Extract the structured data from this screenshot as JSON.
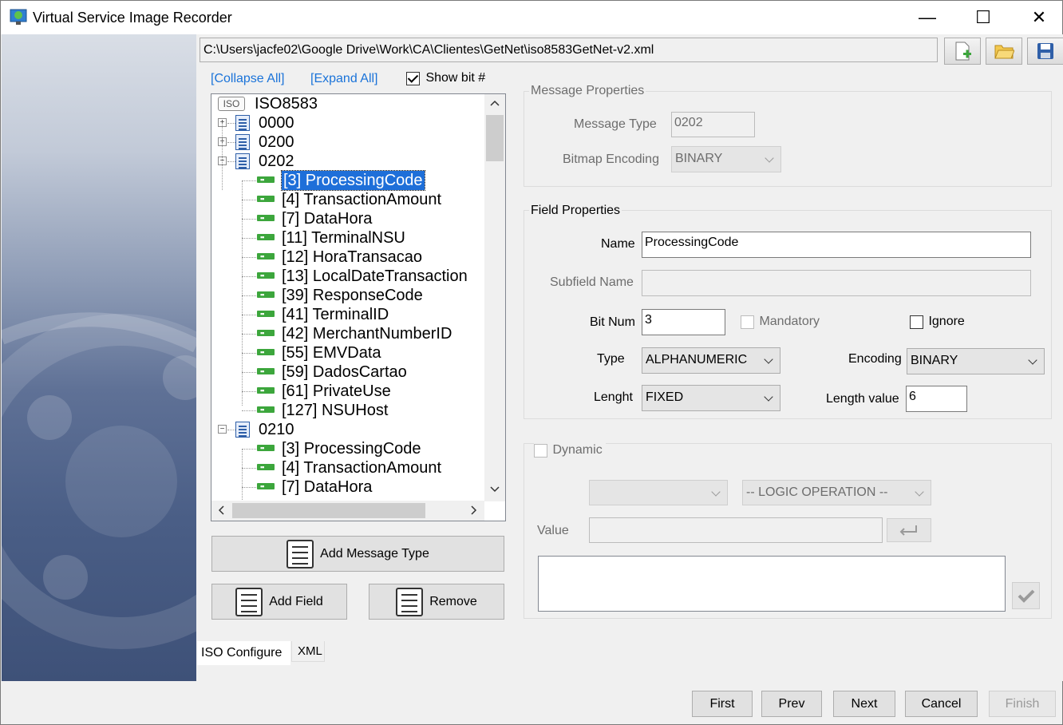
{
  "window": {
    "title": "Virtual Service Image Recorder",
    "minimize": "—",
    "maximize": "☐",
    "close": "✕"
  },
  "path": "C:\\Users\\jacfe02\\Google Drive\\Work\\CA\\Clientes\\GetNet\\iso8583GetNet-v2.xml",
  "links": {
    "collapse_all": "[Collapse All]",
    "expand_all": "[Expand All]"
  },
  "show_bit": {
    "label": "Show bit #",
    "checked": true
  },
  "tree": {
    "root_badge": "ISO",
    "root": "ISO8583",
    "rows": [
      {
        "label": "0000",
        "kind": "msg",
        "expander": "+"
      },
      {
        "label": "0200",
        "kind": "msg",
        "expander": "+"
      },
      {
        "label": "0202",
        "kind": "msg",
        "expander": "−"
      },
      {
        "label": "[3] ProcessingCode",
        "kind": "field",
        "selected": true
      },
      {
        "label": "[4] TransactionAmount",
        "kind": "field"
      },
      {
        "label": "[7] DataHora",
        "kind": "field"
      },
      {
        "label": "[11] TerminalNSU",
        "kind": "field"
      },
      {
        "label": "[12] HoraTransacao",
        "kind": "field"
      },
      {
        "label": "[13] LocalDateTransaction",
        "kind": "field"
      },
      {
        "label": "[39] ResponseCode",
        "kind": "field"
      },
      {
        "label": "[41] TerminalID",
        "kind": "field"
      },
      {
        "label": "[42] MerchantNumberID",
        "kind": "field"
      },
      {
        "label": "[55] EMVData",
        "kind": "field"
      },
      {
        "label": "[59] DadosCartao",
        "kind": "field"
      },
      {
        "label": "[61] PrivateUse",
        "kind": "field"
      },
      {
        "label": "[127] NSUHost",
        "kind": "field"
      },
      {
        "label": "0210",
        "kind": "msg",
        "expander": "−"
      },
      {
        "label": "[3] ProcessingCode",
        "kind": "field"
      },
      {
        "label": "[4] TransactionAmount",
        "kind": "field"
      },
      {
        "label": "[7] DataHora",
        "kind": "field"
      }
    ]
  },
  "buttons": {
    "add_message_type": "Add Message Type",
    "add_field": "Add Field",
    "remove": "Remove"
  },
  "message_properties": {
    "title": "Message Properties",
    "message_type_label": "Message Type",
    "message_type_value": "0202",
    "bitmap_encoding_label": "Bitmap Encoding",
    "bitmap_encoding_value": "BINARY"
  },
  "field_properties": {
    "title": "Field Properties",
    "name_label": "Name",
    "name_value": "ProcessingCode",
    "subfield_label": "Subfield Name",
    "subfield_value": "",
    "bitnum_label": "Bit Num",
    "bitnum_value": "3",
    "mandatory_label": "Mandatory",
    "ignore_label": "Ignore",
    "type_label": "Type",
    "type_value": "ALPHANUMERIC",
    "encoding_label": "Encoding",
    "encoding_value": "BINARY",
    "length_label": "Lenght",
    "length_value_sel": "FIXED",
    "length_value_label": "Length value",
    "length_value": "6"
  },
  "dynamic": {
    "label": "Dynamic",
    "field_select": "",
    "logic_operation": "-- LOGIC OPERATION --",
    "value_label": "Value",
    "value": ""
  },
  "tabs": {
    "iso_configure": "ISO Configure",
    "xml": "XML"
  },
  "footer": {
    "first": "First",
    "prev": "Prev",
    "next": "Next",
    "cancel": "Cancel",
    "finish": "Finish"
  },
  "colors": {
    "selection": "#1e6fd9",
    "link": "#1a73d9",
    "field_icon": "#3ca63c"
  }
}
